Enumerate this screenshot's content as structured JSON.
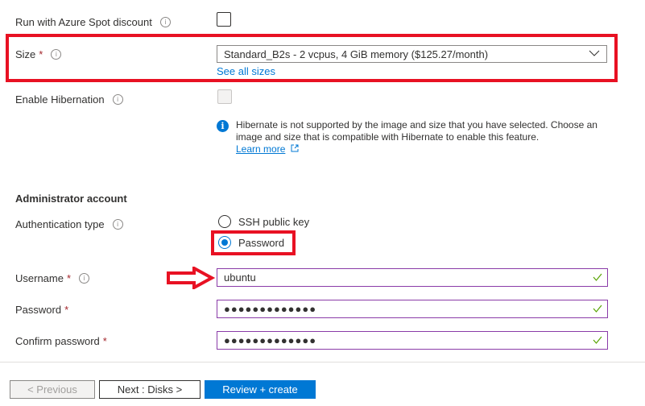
{
  "spot": {
    "label": "Run with Azure Spot discount",
    "info_icon": "info-icon",
    "checked": false
  },
  "size": {
    "label": "Size",
    "required_marker": "*",
    "info_icon": "info-icon",
    "selected": "Standard_B2s - 2 vcpus, 4 GiB memory ($125.27/month)",
    "see_all_link": "See all sizes",
    "highlighted": true
  },
  "hibernation": {
    "label": "Enable Hibernation",
    "info_icon": "info-icon",
    "checked": false,
    "disabled": true,
    "notice_icon": "info-filled-icon",
    "notice_text": "Hibernate is not supported by the image and size that you have selected. Choose an image and size that is compatible with Hibernate to enable this feature.",
    "learn_more": "Learn more",
    "learn_more_icon": "external-link-icon"
  },
  "admin": {
    "heading": "Administrator account",
    "auth_type": {
      "label": "Authentication type",
      "info_icon": "info-icon",
      "options": [
        {
          "label": "SSH public key",
          "selected": false
        },
        {
          "label": "Password",
          "selected": true
        }
      ]
    },
    "username": {
      "label": "Username",
      "required_marker": "*",
      "value": "ubuntu",
      "valid": true
    },
    "password": {
      "label": "Password",
      "required_marker": "*",
      "masked_value": "●●●●●●●●●●●●●",
      "valid": true
    },
    "confirm_password": {
      "label": "Confirm password",
      "required_marker": "*",
      "masked_value": "●●●●●●●●●●●●●",
      "valid": true
    }
  },
  "annotations": {
    "highlight_color": "#e81123",
    "arrow_icon": "right-arrow-annotation"
  },
  "footer": {
    "previous_label": "< Previous",
    "next_label": "Next : Disks >",
    "review_label": "Review + create"
  },
  "colors": {
    "accent": "#0078d4",
    "valid": "#57a300",
    "input_border": "#8a3ba8",
    "required": "#a4262c"
  }
}
